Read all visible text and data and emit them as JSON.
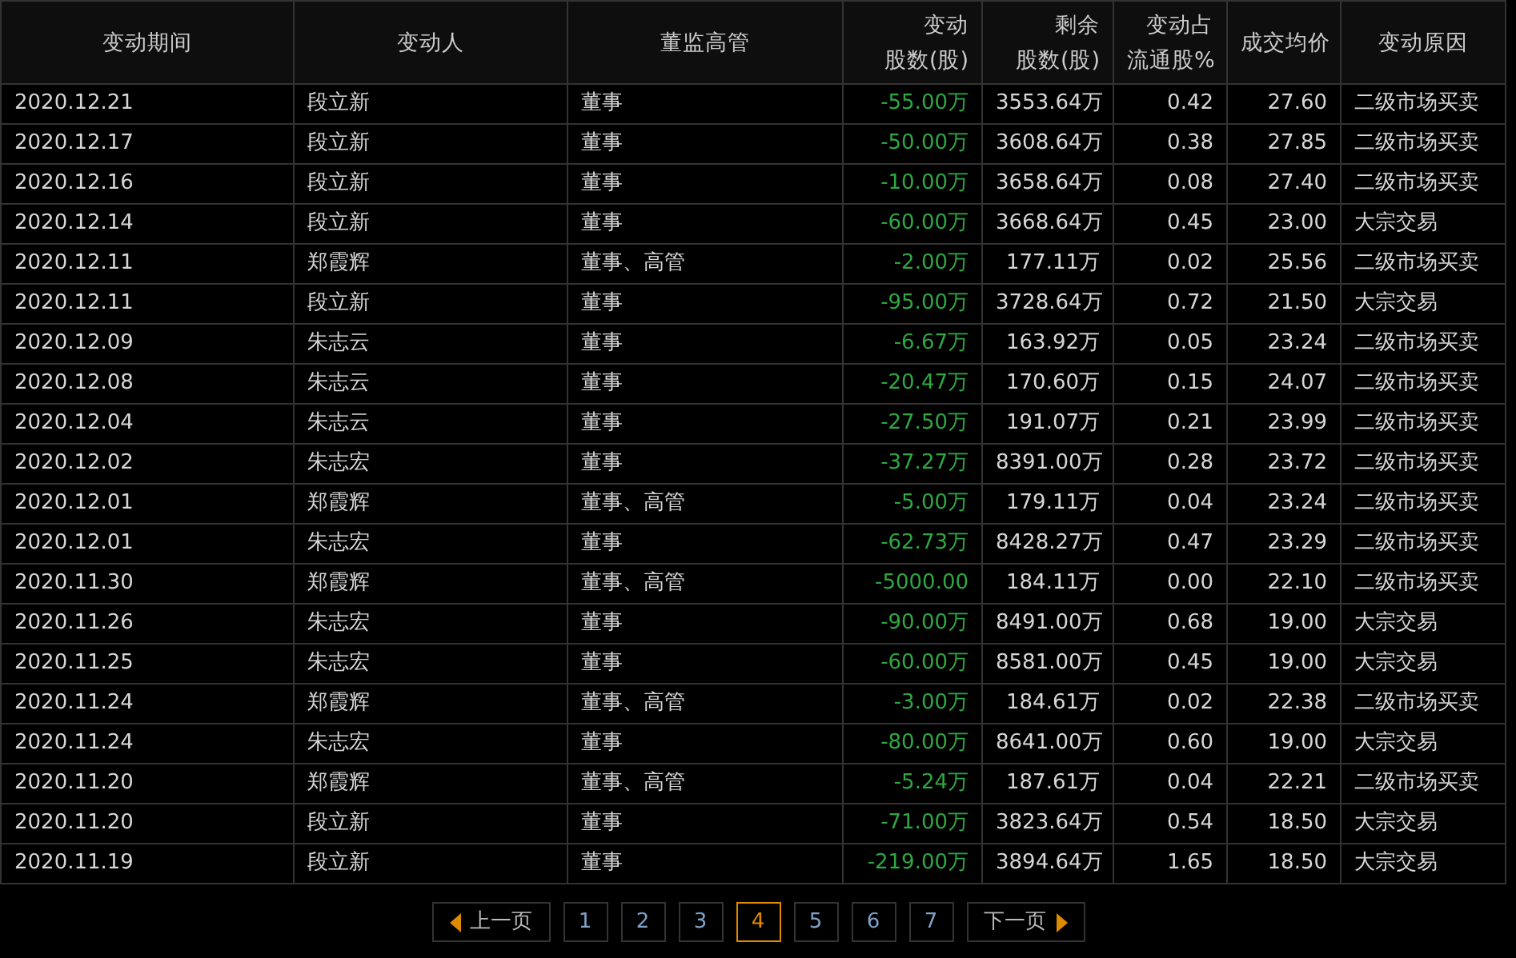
{
  "table": {
    "columns": [
      {
        "lines": [
          "变动期间"
        ]
      },
      {
        "lines": [
          "变动人"
        ]
      },
      {
        "lines": [
          "董监高管"
        ]
      },
      {
        "lines": [
          "变动",
          "股数(股)"
        ]
      },
      {
        "lines": [
          "剩余",
          "股数(股)"
        ]
      },
      {
        "lines": [
          "变动占",
          "流通股%"
        ]
      },
      {
        "lines": [
          "成交均价"
        ]
      },
      {
        "lines": [
          "变动原因"
        ]
      }
    ],
    "rows": [
      [
        "2020.12.21",
        "段立新",
        "董事",
        "-55.00万",
        "3553.64万",
        "0.42",
        "27.60",
        "二级市场买卖"
      ],
      [
        "2020.12.17",
        "段立新",
        "董事",
        "-50.00万",
        "3608.64万",
        "0.38",
        "27.85",
        "二级市场买卖"
      ],
      [
        "2020.12.16",
        "段立新",
        "董事",
        "-10.00万",
        "3658.64万",
        "0.08",
        "27.40",
        "二级市场买卖"
      ],
      [
        "2020.12.14",
        "段立新",
        "董事",
        "-60.00万",
        "3668.64万",
        "0.45",
        "23.00",
        "大宗交易"
      ],
      [
        "2020.12.11",
        "郑霞辉",
        "董事、高管",
        "-2.00万",
        "177.11万",
        "0.02",
        "25.56",
        "二级市场买卖"
      ],
      [
        "2020.12.11",
        "段立新",
        "董事",
        "-95.00万",
        "3728.64万",
        "0.72",
        "21.50",
        "大宗交易"
      ],
      [
        "2020.12.09",
        "朱志云",
        "董事",
        "-6.67万",
        "163.92万",
        "0.05",
        "23.24",
        "二级市场买卖"
      ],
      [
        "2020.12.08",
        "朱志云",
        "董事",
        "-20.47万",
        "170.60万",
        "0.15",
        "24.07",
        "二级市场买卖"
      ],
      [
        "2020.12.04",
        "朱志云",
        "董事",
        "-27.50万",
        "191.07万",
        "0.21",
        "23.99",
        "二级市场买卖"
      ],
      [
        "2020.12.02",
        "朱志宏",
        "董事",
        "-37.27万",
        "8391.00万",
        "0.28",
        "23.72",
        "二级市场买卖"
      ],
      [
        "2020.12.01",
        "郑霞辉",
        "董事、高管",
        "-5.00万",
        "179.11万",
        "0.04",
        "23.24",
        "二级市场买卖"
      ],
      [
        "2020.12.01",
        "朱志宏",
        "董事",
        "-62.73万",
        "8428.27万",
        "0.47",
        "23.29",
        "二级市场买卖"
      ],
      [
        "2020.11.30",
        "郑霞辉",
        "董事、高管",
        "-5000.00",
        "184.11万",
        "0.00",
        "22.10",
        "二级市场买卖"
      ],
      [
        "2020.11.26",
        "朱志宏",
        "董事",
        "-90.00万",
        "8491.00万",
        "0.68",
        "19.00",
        "大宗交易"
      ],
      [
        "2020.11.25",
        "朱志宏",
        "董事",
        "-60.00万",
        "8581.00万",
        "0.45",
        "19.00",
        "大宗交易"
      ],
      [
        "2020.11.24",
        "郑霞辉",
        "董事、高管",
        "-3.00万",
        "184.61万",
        "0.02",
        "22.38",
        "二级市场买卖"
      ],
      [
        "2020.11.24",
        "朱志宏",
        "董事",
        "-80.00万",
        "8641.00万",
        "0.60",
        "19.00",
        "大宗交易"
      ],
      [
        "2020.11.20",
        "郑霞辉",
        "董事、高管",
        "-5.24万",
        "187.61万",
        "0.04",
        "22.21",
        "二级市场买卖"
      ],
      [
        "2020.11.20",
        "段立新",
        "董事",
        "-71.00万",
        "3823.64万",
        "0.54",
        "18.50",
        "大宗交易"
      ],
      [
        "2020.11.19",
        "段立新",
        "董事",
        "-219.00万",
        "3894.64万",
        "1.65",
        "18.50",
        "大宗交易"
      ]
    ]
  },
  "pagination": {
    "prev": "上一页",
    "next": "下一页",
    "pages": [
      {
        "label": "1",
        "selected": false
      },
      {
        "label": "2",
        "selected": false
      },
      {
        "label": "3",
        "selected": false
      },
      {
        "label": "4",
        "selected": true
      },
      {
        "label": "5",
        "selected": false
      },
      {
        "label": "6",
        "selected": false
      },
      {
        "label": "7",
        "selected": false
      }
    ]
  }
}
